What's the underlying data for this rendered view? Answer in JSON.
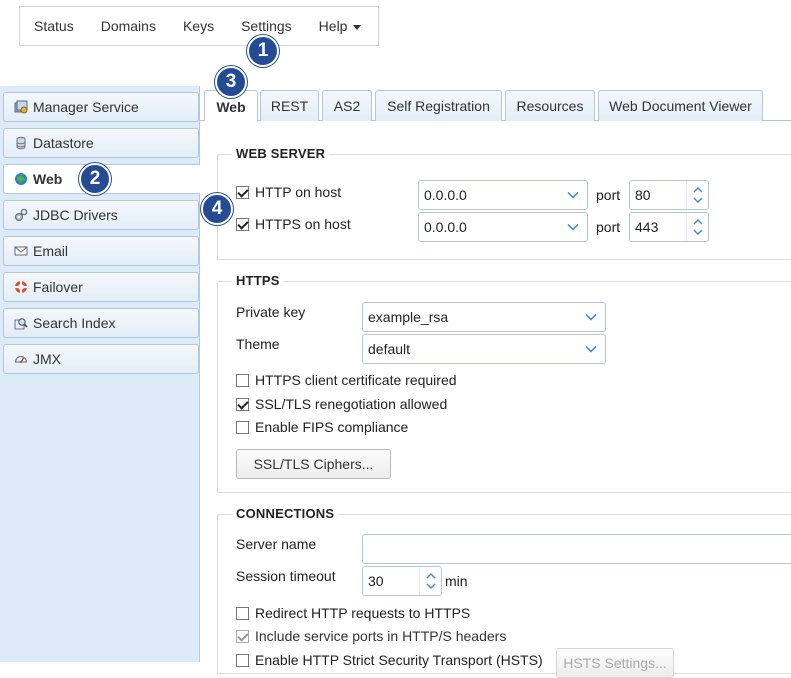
{
  "topnav": {
    "items": [
      "Status",
      "Domains",
      "Keys",
      "Settings",
      "Help"
    ]
  },
  "callouts": [
    "1",
    "2",
    "3",
    "4"
  ],
  "sidebar": {
    "items": [
      {
        "label": "Manager Service",
        "icon": "manager-service-icon"
      },
      {
        "label": "Datastore",
        "icon": "datastore-icon"
      },
      {
        "label": "Web",
        "icon": "globe-icon"
      },
      {
        "label": "JDBC Drivers",
        "icon": "jdbc-drivers-icon"
      },
      {
        "label": "Email",
        "icon": "email-icon"
      },
      {
        "label": "Failover",
        "icon": "lifebuoy-icon"
      },
      {
        "label": "Search Index",
        "icon": "search-index-icon"
      },
      {
        "label": "JMX",
        "icon": "gauge-icon"
      }
    ],
    "active": "Web"
  },
  "tabs": [
    "Web",
    "REST",
    "AS2",
    "Self Registration",
    "Resources",
    "Web Document Viewer"
  ],
  "web_server": {
    "title": "WEB SERVER",
    "http_label": "HTTP on host",
    "http_checked": true,
    "http_host": "0.0.0.0",
    "http_port_label": "port",
    "http_port": "80",
    "https_label": "HTTPS on host",
    "https_checked": true,
    "https_host": "0.0.0.0",
    "https_port_label": "port",
    "https_port": "443"
  },
  "https": {
    "title": "HTTPS",
    "private_key_label": "Private key",
    "private_key_value": "example_rsa",
    "theme_label": "Theme",
    "theme_value": "default",
    "client_cert_label": "HTTPS client certificate required",
    "client_cert_checked": false,
    "renegotiation_label": "SSL/TLS renegotiation allowed",
    "renegotiation_checked": true,
    "fips_label": "Enable FIPS compliance",
    "fips_checked": false,
    "ciphers_button": "SSL/TLS Ciphers..."
  },
  "connections": {
    "title": "CONNECTIONS",
    "server_name_label": "Server name",
    "server_name_value": "",
    "session_timeout_label": "Session timeout",
    "session_timeout_value": "30",
    "session_timeout_unit": "min",
    "redirect_label": "Redirect HTTP requests to HTTPS",
    "redirect_checked": false,
    "include_ports_label": "Include service ports in HTTP/S headers",
    "include_ports_checked": true,
    "hsts_label": "Enable HTTP Strict Security Transport (HSTS)",
    "hsts_checked": false,
    "hsts_button": "HSTS Settings..."
  },
  "colors": {
    "callout": "#244b93",
    "sidebar_bg": "#ddeaf7",
    "border": "#b4c6da",
    "chevron": "#4a8fd0"
  }
}
